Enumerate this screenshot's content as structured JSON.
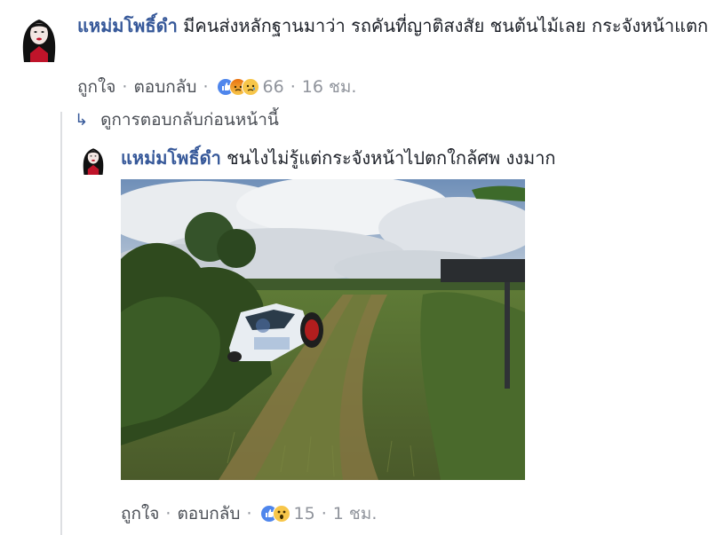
{
  "main_comment": {
    "author": "แหม่มโพธิ์ดำ",
    "text": "มีคนส่งหลักฐานมาว่า รถคันที่ญาติสงสัย ชนต้นไม้เลย กระจังหน้าแตก",
    "like_label": "ถูกใจ",
    "reply_label": "ตอบกลับ",
    "reaction_count": "66",
    "time": "16 ชม.",
    "reactions": [
      "like-reaction-icon",
      "angry-reaction-icon",
      "sad-reaction-icon"
    ]
  },
  "previous_replies": {
    "label": "ดูการตอบกลับก่อนหน้านี้"
  },
  "reply": {
    "author": "แหม่มโพธิ์ดำ",
    "text": "ชนไงไม่รู้แต่กระจังหน้าไปตกใกล้ศพ งงมาก",
    "like_label": "ถูกใจ",
    "reply_label": "ตอบกลับ",
    "reaction_count": "15",
    "time": "1 ชม.",
    "reactions": [
      "like-reaction-icon",
      "wow-reaction-icon"
    ]
  },
  "colors": {
    "author": "#365899",
    "meta": "#90949c",
    "like_blue": "#4f86ec",
    "angry": "#e9710f",
    "haha_yellow": "#f7c64a",
    "thread_line": "#dddfe2"
  }
}
